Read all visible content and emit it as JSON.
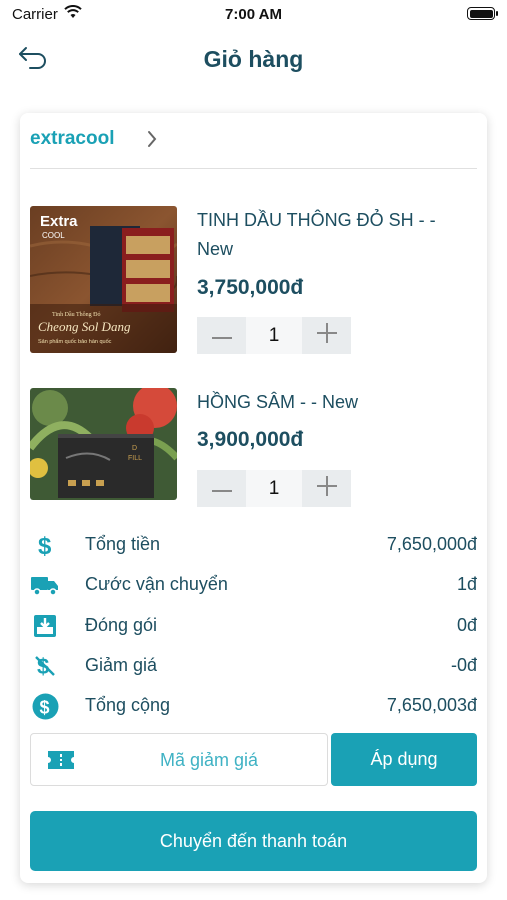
{
  "status_bar": {
    "carrier": "Carrier",
    "time": "7:00 AM"
  },
  "header": {
    "title": "Giỏ hàng",
    "back_icon": "back-arrow-icon"
  },
  "shop": {
    "name": "extracool",
    "chevron_icon": "chevron-right-icon"
  },
  "products": [
    {
      "name": "TINH DẦU THÔNG ĐỎ SH -  -  New",
      "price": "3,750,000đ",
      "quantity": "1",
      "image_text": {
        "brand_line1": "Extra",
        "brand_line2": "COOL",
        "small_caption": "Tinh Dầu Thông Đỏ",
        "script_name": "Cheong Sol Dang",
        "tagline": "Sản phẩm quốc bảo hàn quốc"
      }
    },
    {
      "name": "HỒNG SÂM -  - New",
      "price": "3,900,000đ",
      "quantity": "1",
      "image_text": {
        "box_line1": "D",
        "box_line2": "FILL"
      }
    }
  ],
  "summary": [
    {
      "icon": "dollar-icon",
      "label": "Tổng tiền",
      "value": "7,650,000đ"
    },
    {
      "icon": "truck-icon",
      "label": "Cước vận chuyển",
      "value": "1đ"
    },
    {
      "icon": "package-icon",
      "label": "Đóng gói",
      "value": "0đ"
    },
    {
      "icon": "discount-icon",
      "label": "Giảm giá",
      "value": "-0đ"
    },
    {
      "icon": "dollar-circle-icon",
      "label": "Tổng cộng",
      "value": "7,650,003đ"
    }
  ],
  "coupon": {
    "placeholder": "Mã giảm giá",
    "icon": "ticket-icon",
    "apply_label": "Áp dụng"
  },
  "checkout_label": "Chuyển đến thanh toán",
  "colors": {
    "accent": "#1aa1b5",
    "text_dark": "#1d4e60"
  }
}
